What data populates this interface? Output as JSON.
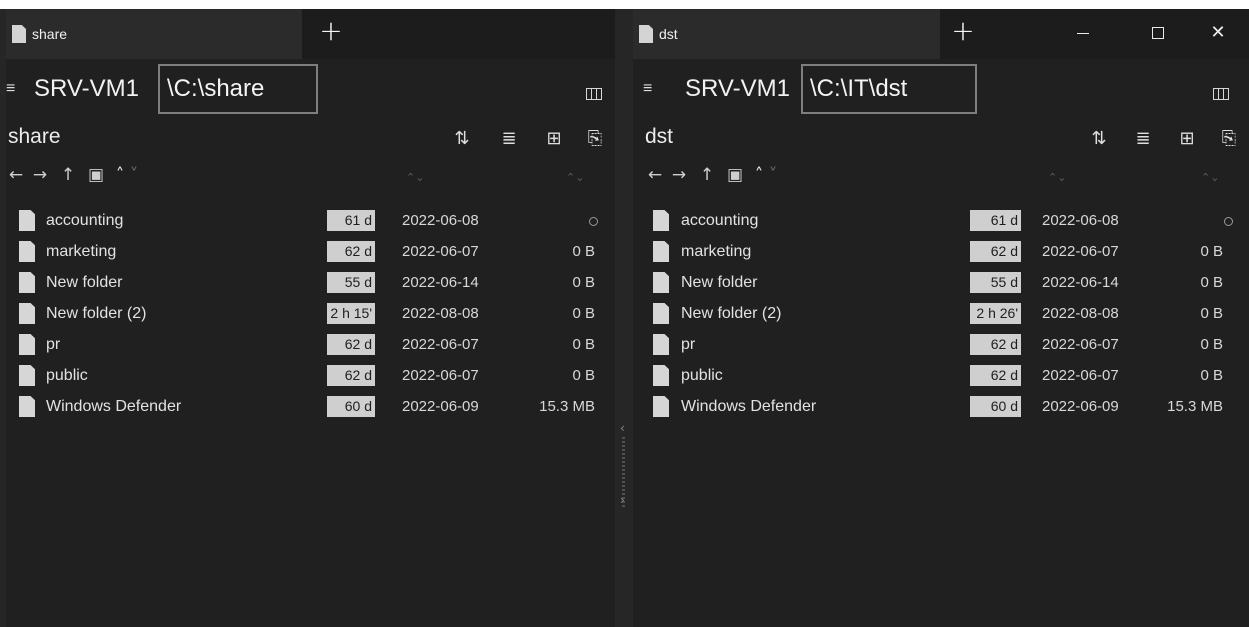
{
  "left_pane": {
    "tab_label": "share",
    "address_host": "SRV-VM1",
    "address_path": "\\C:\\share",
    "folder_title": "share",
    "rows": [
      {
        "name": "accounting",
        "age": "61 d",
        "date": "2022-06-08",
        "size": ""
      },
      {
        "name": "marketing",
        "age": "62 d",
        "date": "2022-06-07",
        "size": "0 B"
      },
      {
        "name": "New folder",
        "age": "55 d",
        "date": "2022-06-14",
        "size": "0 B"
      },
      {
        "name": "New folder (2)",
        "age": "2 h 15'",
        "date": "2022-08-08",
        "size": "0 B"
      },
      {
        "name": "pr",
        "age": "62 d",
        "date": "2022-06-07",
        "size": "0 B"
      },
      {
        "name": "public",
        "age": "62 d",
        "date": "2022-06-07",
        "size": "0 B"
      },
      {
        "name": "Windows Defender",
        "age": "60 d",
        "date": "2022-06-09",
        "size": "15.3 MB"
      }
    ]
  },
  "right_pane": {
    "tab_label": "dst",
    "address_host": "SRV-VM1",
    "address_path": "\\C:\\IT\\dst",
    "folder_title": "dst",
    "rows": [
      {
        "name": "accounting",
        "age": "61 d",
        "date": "2022-06-08",
        "size": ""
      },
      {
        "name": "marketing",
        "age": "62 d",
        "date": "2022-06-07",
        "size": "0 B"
      },
      {
        "name": "New folder",
        "age": "55 d",
        "date": "2022-06-14",
        "size": "0 B"
      },
      {
        "name": "New folder (2)",
        "age": "2 h 26'",
        "date": "2022-08-08",
        "size": "0 B"
      },
      {
        "name": "pr",
        "age": "62 d",
        "date": "2022-06-07",
        "size": "0 B"
      },
      {
        "name": "public",
        "age": "62 d",
        "date": "2022-06-07",
        "size": "0 B"
      },
      {
        "name": "Windows Defender",
        "age": "60 d",
        "date": "2022-06-09",
        "size": "15.3 MB"
      }
    ]
  },
  "icons": {
    "new_tab": "+",
    "menu": "≡",
    "sort": "⇅",
    "list_view": "≣",
    "expand": "⊞",
    "paste": "⎘",
    "back": "←",
    "forward": "→",
    "up": "↑",
    "image_folder": "▣",
    "chevron_up": "˄",
    "chevron_down": "˅",
    "close": "✕",
    "collapse_left": "‹",
    "expand_right": "›"
  },
  "colors": {
    "background": "#202020",
    "tab_active": "#2b2b2b",
    "age_badge": "#cfcfcf",
    "address_border": "#7e7e7e"
  }
}
